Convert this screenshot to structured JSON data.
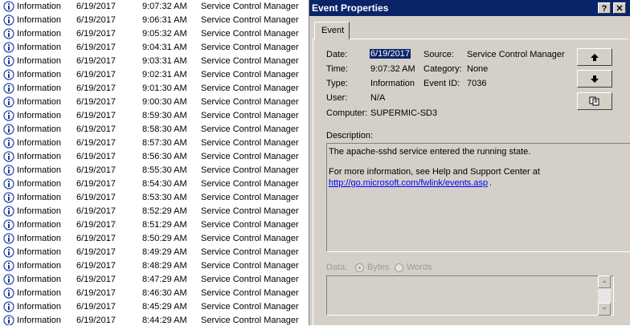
{
  "event_list": {
    "rows": [
      {
        "type": "Information",
        "date": "6/19/2017",
        "time": "9:07:32 AM",
        "source": "Service Control Manager"
      },
      {
        "type": "Information",
        "date": "6/19/2017",
        "time": "9:06:31 AM",
        "source": "Service Control Manager"
      },
      {
        "type": "Information",
        "date": "6/19/2017",
        "time": "9:05:32 AM",
        "source": "Service Control Manager"
      },
      {
        "type": "Information",
        "date": "6/19/2017",
        "time": "9:04:31 AM",
        "source": "Service Control Manager"
      },
      {
        "type": "Information",
        "date": "6/19/2017",
        "time": "9:03:31 AM",
        "source": "Service Control Manager"
      },
      {
        "type": "Information",
        "date": "6/19/2017",
        "time": "9:02:31 AM",
        "source": "Service Control Manager"
      },
      {
        "type": "Information",
        "date": "6/19/2017",
        "time": "9:01:30 AM",
        "source": "Service Control Manager"
      },
      {
        "type": "Information",
        "date": "6/19/2017",
        "time": "9:00:30 AM",
        "source": "Service Control Manager"
      },
      {
        "type": "Information",
        "date": "6/19/2017",
        "time": "8:59:30 AM",
        "source": "Service Control Manager"
      },
      {
        "type": "Information",
        "date": "6/19/2017",
        "time": "8:58:30 AM",
        "source": "Service Control Manager"
      },
      {
        "type": "Information",
        "date": "6/19/2017",
        "time": "8:57:30 AM",
        "source": "Service Control Manager"
      },
      {
        "type": "Information",
        "date": "6/19/2017",
        "time": "8:56:30 AM",
        "source": "Service Control Manager"
      },
      {
        "type": "Information",
        "date": "6/19/2017",
        "time": "8:55:30 AM",
        "source": "Service Control Manager"
      },
      {
        "type": "Information",
        "date": "6/19/2017",
        "time": "8:54:30 AM",
        "source": "Service Control Manager"
      },
      {
        "type": "Information",
        "date": "6/19/2017",
        "time": "8:53:30 AM",
        "source": "Service Control Manager"
      },
      {
        "type": "Information",
        "date": "6/19/2017",
        "time": "8:52:29 AM",
        "source": "Service Control Manager"
      },
      {
        "type": "Information",
        "date": "6/19/2017",
        "time": "8:51:29 AM",
        "source": "Service Control Manager"
      },
      {
        "type": "Information",
        "date": "6/19/2017",
        "time": "8:50:29 AM",
        "source": "Service Control Manager"
      },
      {
        "type": "Information",
        "date": "6/19/2017",
        "time": "8:49:29 AM",
        "source": "Service Control Manager"
      },
      {
        "type": "Information",
        "date": "6/19/2017",
        "time": "8:48:29 AM",
        "source": "Service Control Manager"
      },
      {
        "type": "Information",
        "date": "6/19/2017",
        "time": "8:47:29 AM",
        "source": "Service Control Manager"
      },
      {
        "type": "Information",
        "date": "6/19/2017",
        "time": "8:46:30 AM",
        "source": "Service Control Manager"
      },
      {
        "type": "Information",
        "date": "6/19/2017",
        "time": "8:45:29 AM",
        "source": "Service Control Manager"
      },
      {
        "type": "Information",
        "date": "6/19/2017",
        "time": "8:44:29 AM",
        "source": "Service Control Manager"
      }
    ],
    "row_icon": "information-icon"
  },
  "dialog": {
    "title": "Event Properties",
    "help_label": "?",
    "close_label": "✕",
    "tab_label": "Event",
    "fields": {
      "date_label": "Date:",
      "date_value": "6/19/2017",
      "source_label": "Source:",
      "source_value": "Service Control Manager",
      "time_label": "Time:",
      "time_value": "9:07:32 AM",
      "category_label": "Category:",
      "category_value": "None",
      "type_label": "Type:",
      "type_value": "Information",
      "event_id_label": "Event ID:",
      "event_id_value": "7036",
      "user_label": "User:",
      "user_value": "N/A",
      "computer_label": "Computer:",
      "computer_value": "SUPERMIC-SD3"
    },
    "buttons": {
      "up_icon": "arrow-up-icon",
      "down_icon": "arrow-down-icon",
      "copy_icon": "copy-icon"
    },
    "description": {
      "label": "Description:",
      "line1": "The apache-sshd service entered the running state.",
      "line2": "For more information, see Help and Support Center at",
      "link": "http://go.microsoft.com/fwlink/events.asp",
      "link_suffix": "."
    },
    "data": {
      "label": "Data:",
      "bytes_label": "Bytes",
      "words_label": "Words",
      "selected": "Bytes"
    },
    "colors": {
      "title_bar": "#0a246a",
      "dialog_face": "#d4d0c8",
      "selection": "#0a246a",
      "link": "#0000ff"
    }
  }
}
